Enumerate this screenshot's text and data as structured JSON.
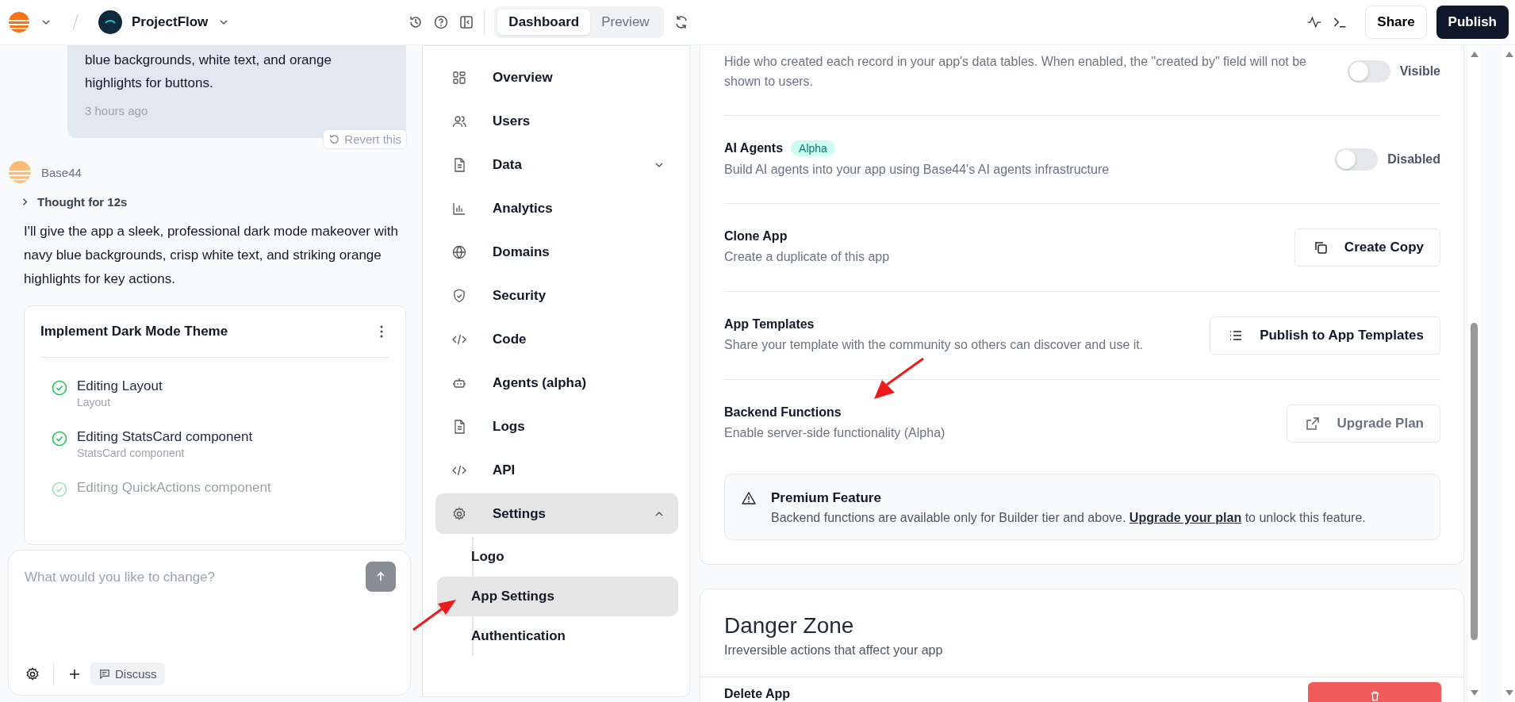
{
  "topbar": {
    "project": "ProjectFlow",
    "tabs": [
      {
        "label": "Dashboard",
        "selected": true
      },
      {
        "label": "Preview",
        "selected": false
      }
    ],
    "share": "Share",
    "publish": "Publish"
  },
  "chat": {
    "user_message": {
      "text": "blue backgrounds, white text, and orange highlights for buttons.",
      "time": "3 hours ago",
      "revert": "Revert this"
    },
    "assistant": {
      "name": "Base44",
      "thought": "Thought for 12s",
      "text": "I'll give the app a sleek, professional dark mode makeover with navy blue backgrounds, crisp white text, and striking orange highlights for key actions.",
      "task": {
        "title": "Implement Dark Mode Theme",
        "steps": [
          {
            "title": "Editing Layout",
            "file": "Layout",
            "done": true
          },
          {
            "title": "Editing StatsCard component",
            "file": "StatsCard component",
            "done": true
          },
          {
            "title": "Editing QuickActions component",
            "done": true
          }
        ]
      }
    },
    "composer": {
      "placeholder": "What would you like to change?",
      "discuss": "Discuss"
    }
  },
  "nav": {
    "items": [
      {
        "label": "Overview",
        "kind": "grid",
        "selected": false
      },
      {
        "label": "Users",
        "kind": "users",
        "selected": false
      },
      {
        "label": "Data",
        "kind": "file",
        "selected": false,
        "expanded": false
      },
      {
        "label": "Analytics",
        "kind": "chart",
        "selected": false
      },
      {
        "label": "Domains",
        "kind": "globe",
        "selected": false
      },
      {
        "label": "Security",
        "kind": "shield",
        "selected": false
      },
      {
        "label": "Code",
        "kind": "code",
        "selected": false
      },
      {
        "label": "Agents (alpha)",
        "kind": "bot",
        "selected": false
      },
      {
        "label": "Logs",
        "kind": "file",
        "selected": false
      },
      {
        "label": "API",
        "kind": "code",
        "selected": false
      },
      {
        "label": "Settings",
        "kind": "gear",
        "selected": true,
        "expanded": true,
        "children": [
          {
            "label": "Logo",
            "selected": false
          },
          {
            "label": "App Settings",
            "selected": true
          },
          {
            "label": "Authentication",
            "selected": false
          }
        ]
      }
    ]
  },
  "settings": {
    "rows": [
      {
        "kind": "toggle",
        "description": "Hide who created each record in your app's data tables. When enabled, the \"created by\" field will not be shown to users.",
        "on": false,
        "state_label": "Visible"
      },
      {
        "kind": "toggle",
        "title": "AI Agents",
        "badge": "Alpha",
        "description": "Build AI agents into your app using Base44's AI agents infrastructure",
        "on": false,
        "state_label": "Disabled"
      },
      {
        "kind": "button",
        "title": "Clone App",
        "description": "Create a duplicate of this app",
        "button": "Create Copy",
        "disabled": false
      },
      {
        "kind": "button",
        "title": "App Templates",
        "description": "Share your template with the community so others can discover and use it.",
        "button": "Publish to App Templates",
        "disabled": false
      },
      {
        "kind": "button",
        "title": "Backend Functions",
        "description": "Enable server-side functionality (Alpha)",
        "button": "Upgrade Plan",
        "disabled": true
      }
    ],
    "notice": {
      "title": "Premium Feature",
      "text_before": "Backend functions are available only for Builder tier and above.",
      "link": "Upgrade your plan",
      "text_after": "to unlock this feature."
    }
  },
  "danger_zone": {
    "title": "Danger Zone",
    "description": "Irreversible actions that affect your app",
    "rows": [
      {
        "title": "Delete App"
      }
    ]
  }
}
